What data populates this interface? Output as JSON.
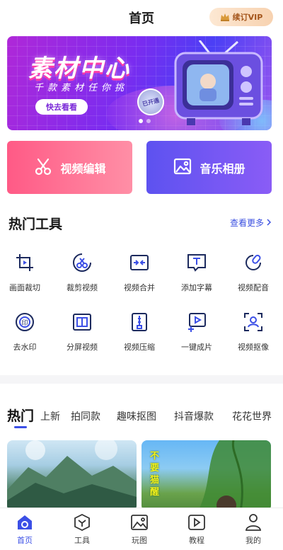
{
  "header": {
    "title": "首页",
    "vip_label": "续订VIP",
    "vip_icon": "crown-icon"
  },
  "banner": {
    "title": "素材中心",
    "subtitle": "千款素材任你挑",
    "cta": "快去看看",
    "badge": "已开通",
    "page_count": 2,
    "active_page": 1
  },
  "feature_cards": [
    {
      "label": "视频编辑",
      "icon": "scissors-icon"
    },
    {
      "label": "音乐相册",
      "icon": "image-icon"
    }
  ],
  "hot_tools": {
    "title": "热门工具",
    "see_more": "查看更多",
    "items": [
      {
        "label": "画面裁切",
        "icon": "crop-icon"
      },
      {
        "label": "裁剪视频",
        "icon": "cut-video-icon"
      },
      {
        "label": "视频合并",
        "icon": "merge-icon"
      },
      {
        "label": "添加字幕",
        "icon": "subtitle-icon"
      },
      {
        "label": "视频配音",
        "icon": "dubbing-icon"
      },
      {
        "label": "去水印",
        "icon": "watermark-remove-icon"
      },
      {
        "label": "分屏视频",
        "icon": "split-screen-icon"
      },
      {
        "label": "视频压缩",
        "icon": "compress-icon"
      },
      {
        "label": "一键成片",
        "icon": "one-click-video-icon"
      },
      {
        "label": "视频抠像",
        "icon": "matting-icon"
      }
    ]
  },
  "category_tabs": [
    "热门",
    "上新",
    "拍同款",
    "趣味抠图",
    "抖音爆款",
    "花花世界"
  ],
  "active_tab": 0,
  "thumbnails": [
    {
      "caption": ""
    },
    {
      "caption": "不要猫醒"
    }
  ],
  "bottom_nav": [
    {
      "label": "首页",
      "icon": "home-icon",
      "active": true
    },
    {
      "label": "工具",
      "icon": "toolbox-icon",
      "active": false
    },
    {
      "label": "玩图",
      "icon": "picture-icon",
      "active": false
    },
    {
      "label": "教程",
      "icon": "tutorial-icon",
      "active": false
    },
    {
      "label": "我的",
      "icon": "profile-icon",
      "active": false
    }
  ],
  "colors": {
    "accent": "#3b4fe6",
    "vip_text": "#a4551b",
    "video_card": "#ff5a86",
    "music_card": "#6a55f2"
  }
}
